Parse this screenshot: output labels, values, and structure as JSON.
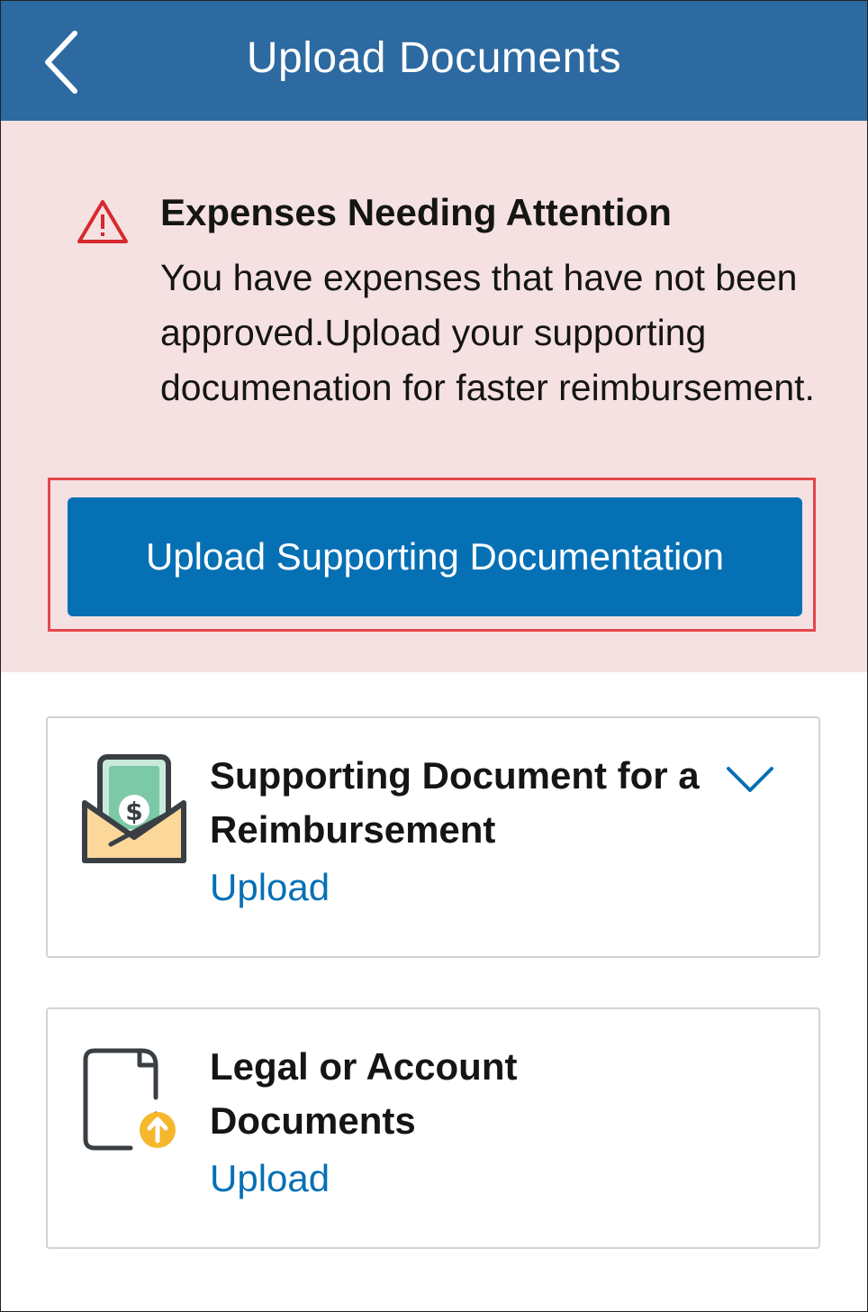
{
  "header": {
    "title": "Upload Documents",
    "back_icon": "chevron-left-icon"
  },
  "alert": {
    "icon": "warning-triangle-icon",
    "title": "Expenses Needing Attention",
    "body": "You have expenses that have not been approved.Upload your supporting documenation for faster reimbursement.",
    "button_label": "Upload Supporting Documentation"
  },
  "cards": [
    {
      "icon": "envelope-money-icon",
      "title": "Supporting Document for a Reimbursement",
      "link_label": "Upload",
      "expand_icon": "chevron-down-icon"
    },
    {
      "icon": "document-upload-icon",
      "title": "Legal or Account Documents",
      "link_label": "Upload"
    }
  ],
  "colors": {
    "header_bg": "#2d6aa1",
    "alert_bg": "#f5e1e1",
    "primary": "#0670b5",
    "warning": "#d6292e",
    "highlight": "#e5474c",
    "badge": "#f5b72b"
  }
}
